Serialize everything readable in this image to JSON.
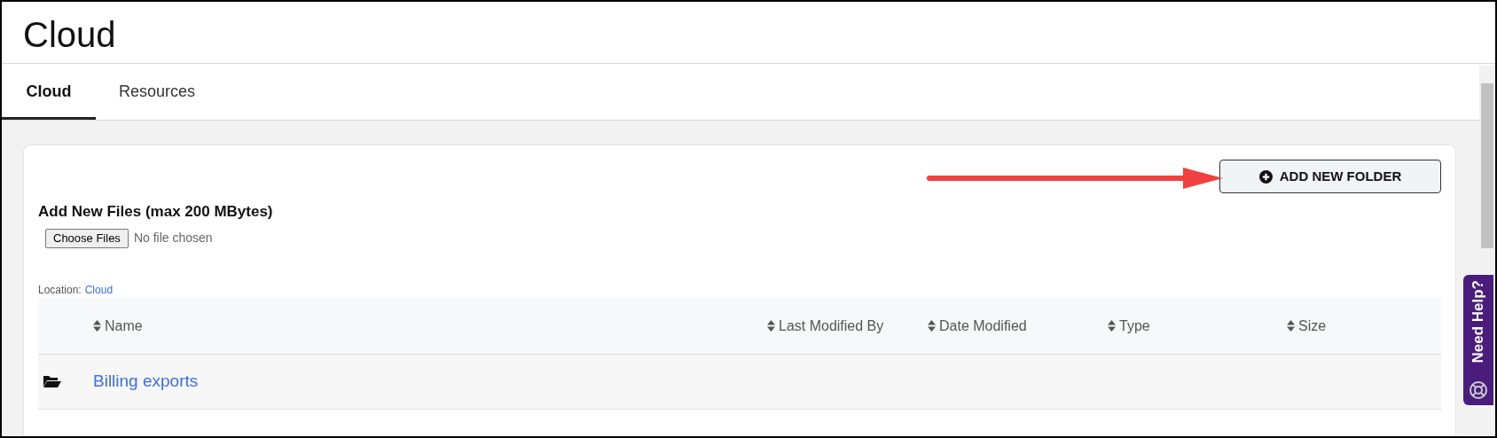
{
  "page_title": "Cloud",
  "tabs": [
    {
      "label": "Cloud",
      "selected": true
    },
    {
      "label": "Resources",
      "selected": false
    }
  ],
  "add_folder_button": "ADD NEW FOLDER",
  "upload": {
    "heading": "Add New Files (max 200 MBytes)",
    "button": "Choose Files",
    "status": "No file chosen"
  },
  "location": {
    "label": "Location:",
    "path": "Cloud"
  },
  "table": {
    "columns": [
      "Name",
      "Last Modified By",
      "Date Modified",
      "Type",
      "Size"
    ],
    "rows": [
      {
        "name": "Billing exports"
      }
    ]
  },
  "help_tab": "Need Help?"
}
